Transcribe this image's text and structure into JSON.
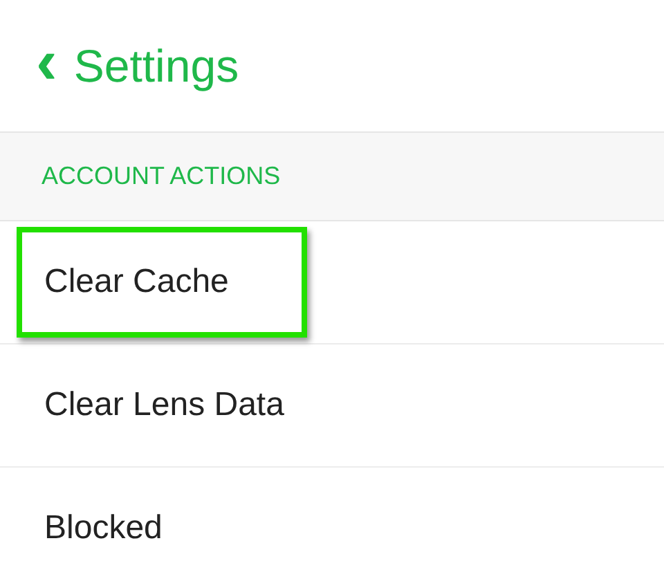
{
  "header": {
    "back_icon": "‹",
    "title": "Settings"
  },
  "section": {
    "title": "ACCOUNT ACTIONS"
  },
  "items": [
    {
      "label": "Clear Cache",
      "highlighted": true
    },
    {
      "label": "Clear Lens Data",
      "highlighted": false
    },
    {
      "label": "Blocked",
      "highlighted": false
    }
  ]
}
